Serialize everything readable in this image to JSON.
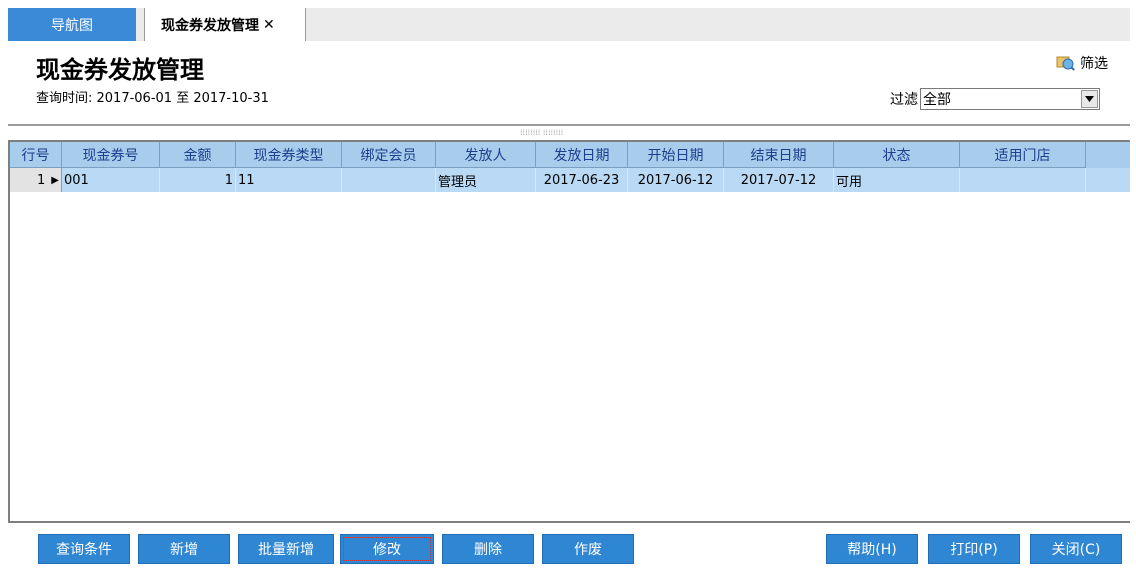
{
  "tabs": {
    "nav_label": "导航图",
    "active_label": "现金券发放管理",
    "close_glyph": "✕"
  },
  "header": {
    "title": "现金券发放管理",
    "query_time": "查询时间: 2017-06-01 至 2017-10-31",
    "filter_link": "筛选",
    "filter_label": "过滤",
    "filter_value": "全部"
  },
  "divider_grip": "⁞⁞⁞⁞⁞⁞⁞⁞ ⁞⁞⁞⁞⁞⁞⁞⁞",
  "grid": {
    "columns": [
      "行号",
      "现金券号",
      "金额",
      "现金券类型",
      "绑定会员",
      "发放人",
      "发放日期",
      "开始日期",
      "结束日期",
      "状态",
      "适用门店"
    ],
    "rows": [
      {
        "row": "1",
        "no": "001",
        "amount": "1",
        "type": "11",
        "member": "",
        "issuer": "管理员",
        "issue_date": "2017-06-23",
        "start_date": "2017-06-12",
        "end_date": "2017-07-12",
        "status": "可用",
        "store": ""
      }
    ]
  },
  "buttons": {
    "query": "查询条件",
    "add": "新增",
    "batch_add": "批量新增",
    "edit": "修改",
    "delete": "删除",
    "void": "作废",
    "help": "帮助(H)",
    "print": "打印(P)",
    "close": "关闭(C)"
  },
  "colors": {
    "accent": "#3a8ad7",
    "button": "#2f86d3",
    "header_bg": "#a7ccec",
    "selected_row": "#b9d9f5"
  }
}
